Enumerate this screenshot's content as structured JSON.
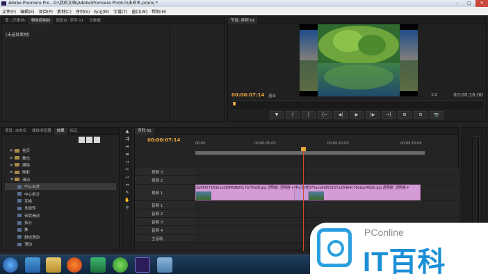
{
  "window": {
    "title": "Adobe Premiere Pro - D:\\我的文档\\Adobe\\Premiere Pro\\6.0\\未命名.prproj *",
    "controls": [
      "–",
      "□",
      "✕"
    ]
  },
  "menu": [
    "文件(F)",
    "编辑(E)",
    "项目(P)",
    "素材(C)",
    "序列(S)",
    "标记(M)",
    "字幕(T)",
    "窗口(W)",
    "帮助(H)"
  ],
  "source_panel": {
    "tabs": [
      "源: (无素材)",
      "特效控制台",
      "调音台: 序列 01",
      "元数据"
    ],
    "no_clip": "(未选择素材)"
  },
  "program_panel": {
    "tab": "节目: 序列 01",
    "timecode": "00:00:07:14",
    "fit": "适合",
    "ratio": "1/2",
    "duration": "00:00:16:00",
    "controls": [
      "▼",
      "{",
      "}",
      "{←",
      "◀|",
      "▶",
      "|▶",
      "→}",
      "⊞",
      "⊟",
      "📷"
    ]
  },
  "project_panel": {
    "tabs": [
      "项目: 未命名",
      "媒体浏览器",
      "效果",
      "标记"
    ],
    "items": [
      {
        "label": "卷页",
        "level": 1,
        "kind": "folder"
      },
      {
        "label": "叠化",
        "level": 1,
        "kind": "folder"
      },
      {
        "label": "擦除",
        "level": 1,
        "kind": "folder"
      },
      {
        "label": "映射",
        "level": 1,
        "kind": "folder"
      },
      {
        "label": "滑动",
        "level": 1,
        "kind": "folder",
        "open": true
      },
      {
        "label": "中心合并",
        "level": 2,
        "kind": "fx",
        "selected": true
      },
      {
        "label": "中心拆分",
        "level": 2,
        "kind": "fx"
      },
      {
        "label": "互换",
        "level": 2,
        "kind": "fx"
      },
      {
        "label": "多旋转",
        "level": 2,
        "kind": "fx"
      },
      {
        "label": "带状滑动",
        "level": 2,
        "kind": "fx"
      },
      {
        "label": "拆分",
        "level": 2,
        "kind": "fx"
      },
      {
        "label": "推",
        "level": 2,
        "kind": "fx"
      },
      {
        "label": "斜线滑动",
        "level": 2,
        "kind": "fx"
      },
      {
        "label": "滑动",
        "level": 2,
        "kind": "fx"
      }
    ]
  },
  "timeline": {
    "tab": "序列 01",
    "timecode": "00:00:07:14",
    "ticks": [
      "00:00",
      "00:00:05:00",
      "00:00:10:00",
      "00:00:15:00"
    ],
    "tracks": [
      {
        "name": "视频 3",
        "type": "video"
      },
      {
        "name": "视频 2",
        "type": "video"
      },
      {
        "name": "视频 1",
        "type": "video"
      },
      {
        "name": "音频 1",
        "type": "audio"
      },
      {
        "name": "音频 2",
        "type": "audio"
      },
      {
        "name": "音频 3",
        "type": "audio"
      },
      {
        "name": "音频 4",
        "type": "audio"
      },
      {
        "name": "主音轨",
        "type": "master"
      }
    ],
    "clips": {
      "clip_a": "3a68f27263e1b289f69626c7b7f0e0f.jpg 透明度: 透明度 ▾",
      "transition": "中心合并",
      "clip_b": "370ace6df53227a29d64c76ebad4620.jpg 透明度: 透明度 ▾"
    }
  },
  "watermark": {
    "brand": "PConline",
    "title": "IT百科"
  }
}
